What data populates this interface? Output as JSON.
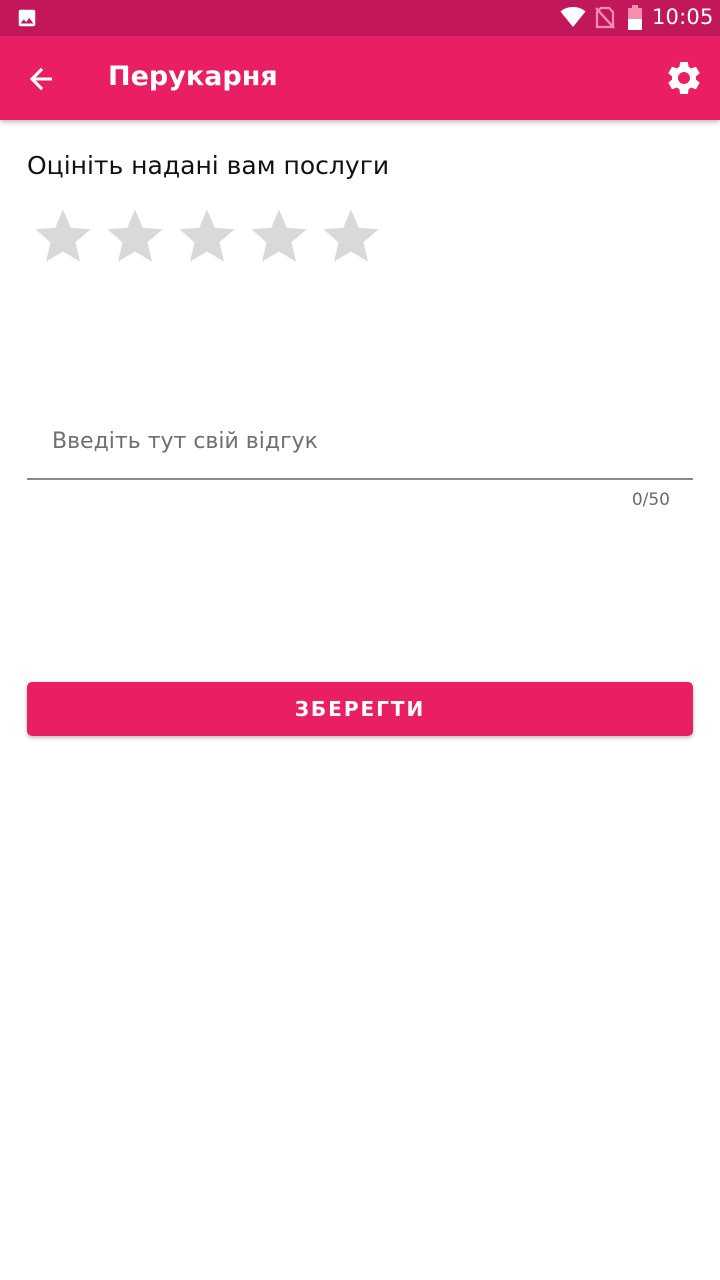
{
  "status_bar": {
    "time": "10:05",
    "icons": [
      "gallery-icon",
      "wifi-icon",
      "no-sim-icon",
      "battery-icon"
    ]
  },
  "app_bar": {
    "title": "Перукарня",
    "back_icon": "arrow-back-icon",
    "settings_icon": "gear-icon",
    "background": "#e91e63"
  },
  "rating": {
    "label": "Оцініть надані вам послуги",
    "value": 0,
    "max": 5,
    "star_color_empty": "#d9d9d9"
  },
  "review": {
    "placeholder": "Введіть тут свій відгук",
    "value": "",
    "counter": "0/50"
  },
  "save_button": {
    "label": "ЗБЕРЕГТИ",
    "color": "#e91e63"
  },
  "colors": {
    "status_bar": "#c2185b",
    "accent": "#e91e63"
  }
}
